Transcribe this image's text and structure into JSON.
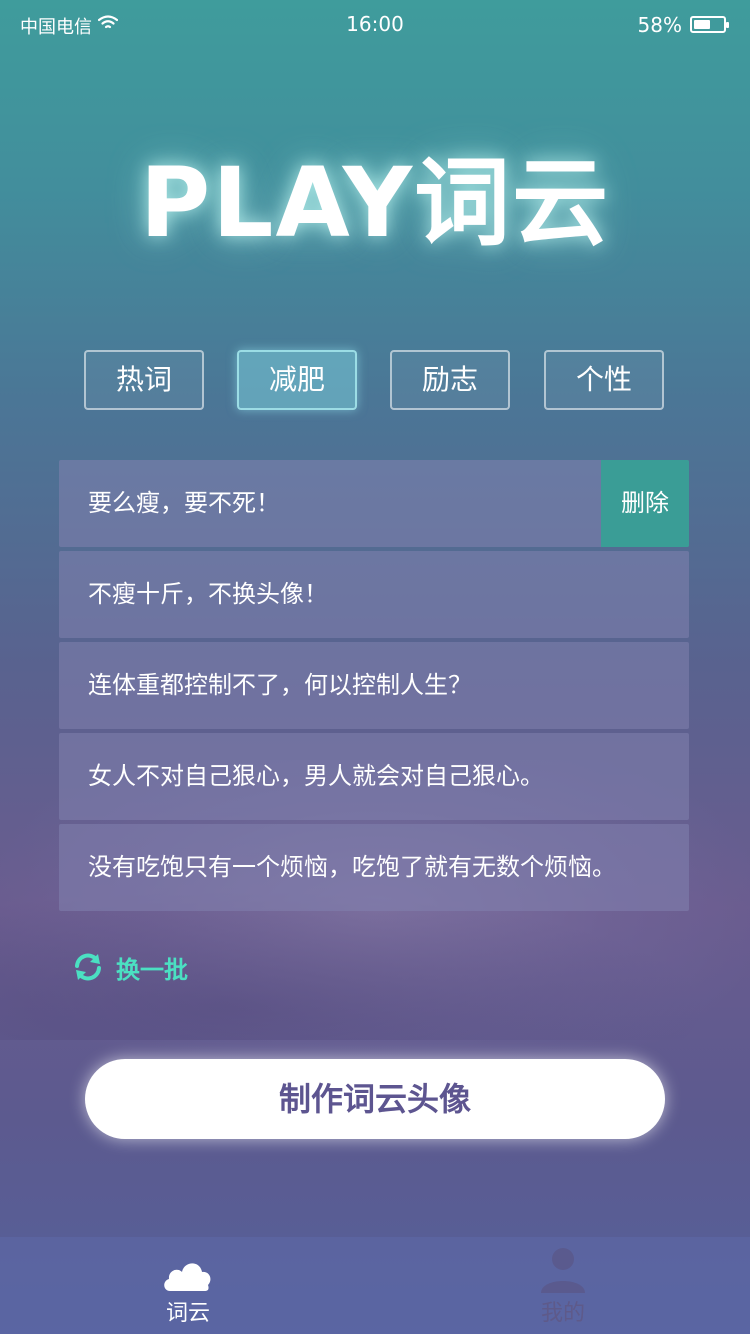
{
  "status_bar": {
    "carrier": "中国电信",
    "time": "16:00",
    "battery_percent": "58%",
    "battery_level": 0.58,
    "wifi_icon": "wifi-icon"
  },
  "logo": {
    "text": "PLAY词云"
  },
  "tabs": [
    {
      "label": "热词",
      "active": false
    },
    {
      "label": "减肥",
      "active": true
    },
    {
      "label": "励志",
      "active": false
    },
    {
      "label": "个性",
      "active": false
    }
  ],
  "phrases": [
    {
      "text": "要么瘦，要不死！",
      "delete_label": "删除"
    },
    {
      "text": "不瘦十斤，不换头像！"
    },
    {
      "text": "连体重都控制不了，何以控制人生？"
    },
    {
      "text": "女人不对自己狠心，男人就会对自己狠心。"
    },
    {
      "text": "没有吃饱只有一个烦恼，吃饱了就有无数个烦恼。"
    }
  ],
  "refresh": {
    "label": "换一批",
    "icon": "refresh-icon",
    "color": "#4be0c2"
  },
  "make_button": {
    "label": "制作词云头像"
  },
  "tab_bar": {
    "items": [
      {
        "label": "词云",
        "icon": "cloud-icon",
        "active": true
      },
      {
        "label": "我的",
        "icon": "user-icon",
        "active": false
      }
    ]
  },
  "colors": {
    "accent": "#3a9d96",
    "button_text": "#5d5590"
  }
}
